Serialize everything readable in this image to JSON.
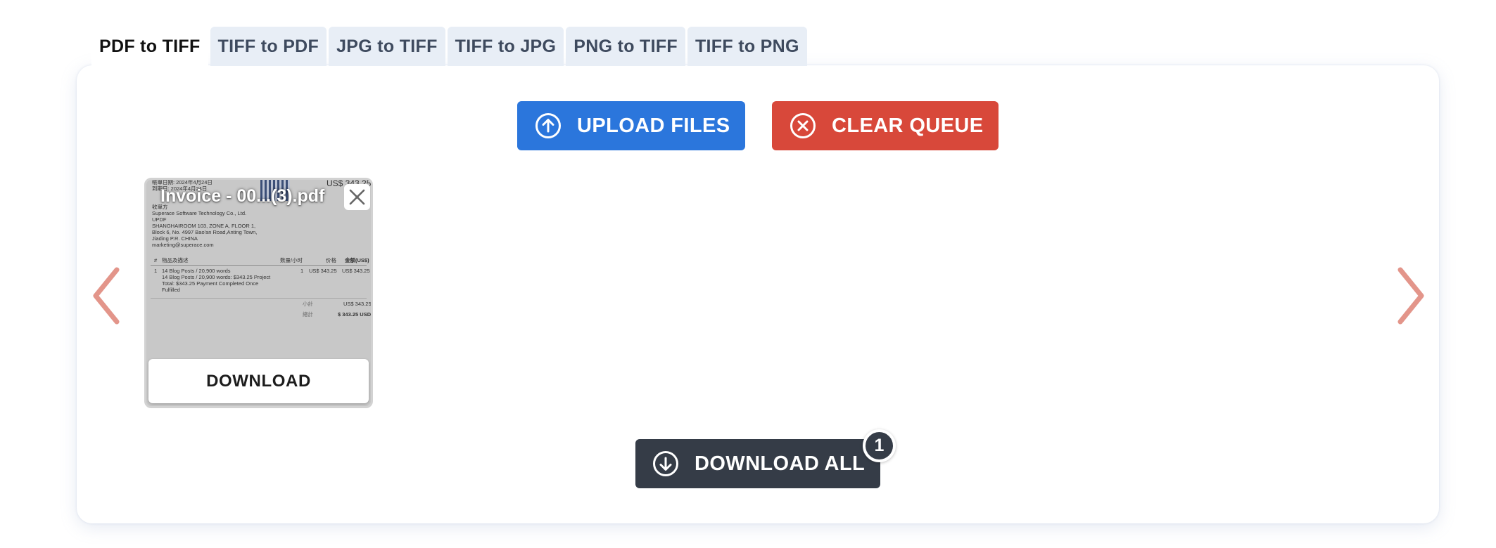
{
  "tabs": [
    {
      "label": "PDF to TIFF",
      "active": true
    },
    {
      "label": "TIFF to PDF",
      "active": false
    },
    {
      "label": "JPG to TIFF",
      "active": false
    },
    {
      "label": "TIFF to JPG",
      "active": false
    },
    {
      "label": "PNG to TIFF",
      "active": false
    },
    {
      "label": "TIFF to PNG",
      "active": false
    }
  ],
  "actions": {
    "upload_label": "UPLOAD FILES",
    "clear_label": "CLEAR QUEUE",
    "download_all_label": "DOWNLOAD ALL",
    "download_all_count": "1"
  },
  "file_card": {
    "file_name": "Invoice - 00...(3).pdf",
    "download_label": "DOWNLOAD",
    "preview": {
      "issue_date": "帳單日期: 2024年4月24日",
      "due_date": "到期日: 2024年4月24日",
      "amount_top": "US$ 343.25",
      "bill_to_label": "收單方",
      "company": "Superace Software Technology Co., Ltd.",
      "product": "UPDF",
      "address_1": "SHANGHAIROOM 103, ZONE A, FLOOR 1,",
      "address_2": "Block 6, No. 4997 Bao'an Road,Anting Town,",
      "address_3": "Jiading P.R. CHINA",
      "email": "marketing@superace.com",
      "col_no": "#",
      "col_item": "物品及描述",
      "col_qty": "数量/小时",
      "col_price": "价格",
      "col_amount": "金额(US$)",
      "row_no": "1",
      "row_desc_1": "14 Blog Posts / 20,900 words",
      "row_desc_2": "14 Blog Posts / 20,900 words: $343.25 Project",
      "row_desc_3": "Total: $343.25 Payment Completed Once",
      "row_desc_4": "Fulfilled",
      "row_qty": "1",
      "row_price": "US$ 343.25",
      "row_amount": "US$ 343.25",
      "subtotal_label": "小計",
      "subtotal_value": "US$ 343.25",
      "total_label": "總計",
      "total_value": "$ 343.25 USD"
    }
  },
  "colors": {
    "upload": "#2b76dc",
    "clear": "#d8483a",
    "download_all": "#353c47",
    "arrows": "#e3958a"
  },
  "icons": [
    "arrow-up-circle-icon",
    "x-circle-icon",
    "arrow-down-circle-icon",
    "chevron-left-icon",
    "chevron-right-icon",
    "close-icon"
  ]
}
